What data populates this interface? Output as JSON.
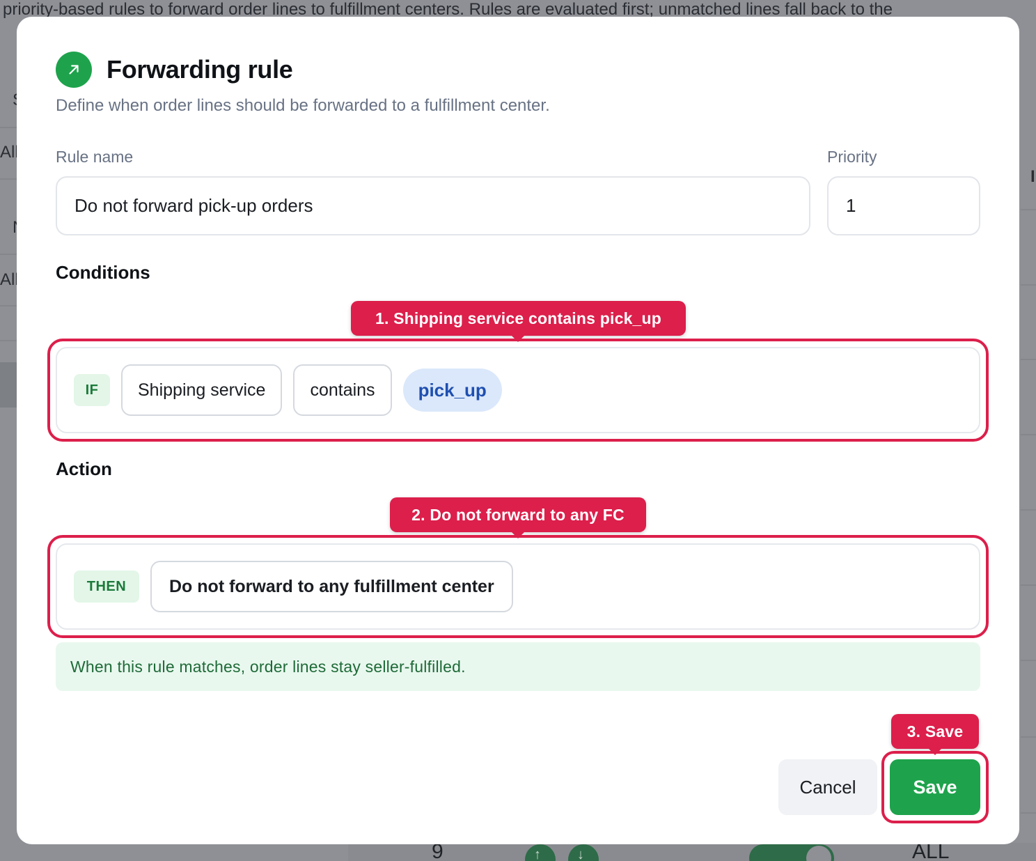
{
  "background": {
    "intro_text": "priority-based rules to forward order lines to fulfillment centers. Rules are evaluated first; unmatched lines fall back to the",
    "fragments": [
      "S",
      "All",
      "N",
      "All"
    ],
    "right_fragment": "I",
    "row_number": "9",
    "row_scope": "ALL"
  },
  "modal": {
    "title": "Forwarding rule",
    "subtitle": "Define when order lines should be forwarded to a fulfillment center.",
    "rule_name": {
      "label": "Rule name",
      "value": "Do not forward pick-up orders"
    },
    "priority": {
      "label": "Priority",
      "value": "1"
    },
    "conditions": {
      "heading": "Conditions",
      "tag": "IF",
      "field": "Shipping service",
      "operator": "contains",
      "value": "pick_up"
    },
    "action": {
      "heading": "Action",
      "tag": "THEN",
      "value": "Do not forward to any fulfillment center"
    },
    "info": "When this rule matches, order lines stay seller-fulfilled.",
    "buttons": {
      "cancel": "Cancel",
      "save": "Save"
    }
  },
  "callouts": {
    "step1": "1. Shipping service contains pick_up",
    "step2": "2. Do not forward to any FC",
    "step3": "3. Save"
  },
  "colors": {
    "accent_green": "#1ea34c",
    "callout_red": "#dc1f4b",
    "value_blue": "#1f4fb0"
  }
}
